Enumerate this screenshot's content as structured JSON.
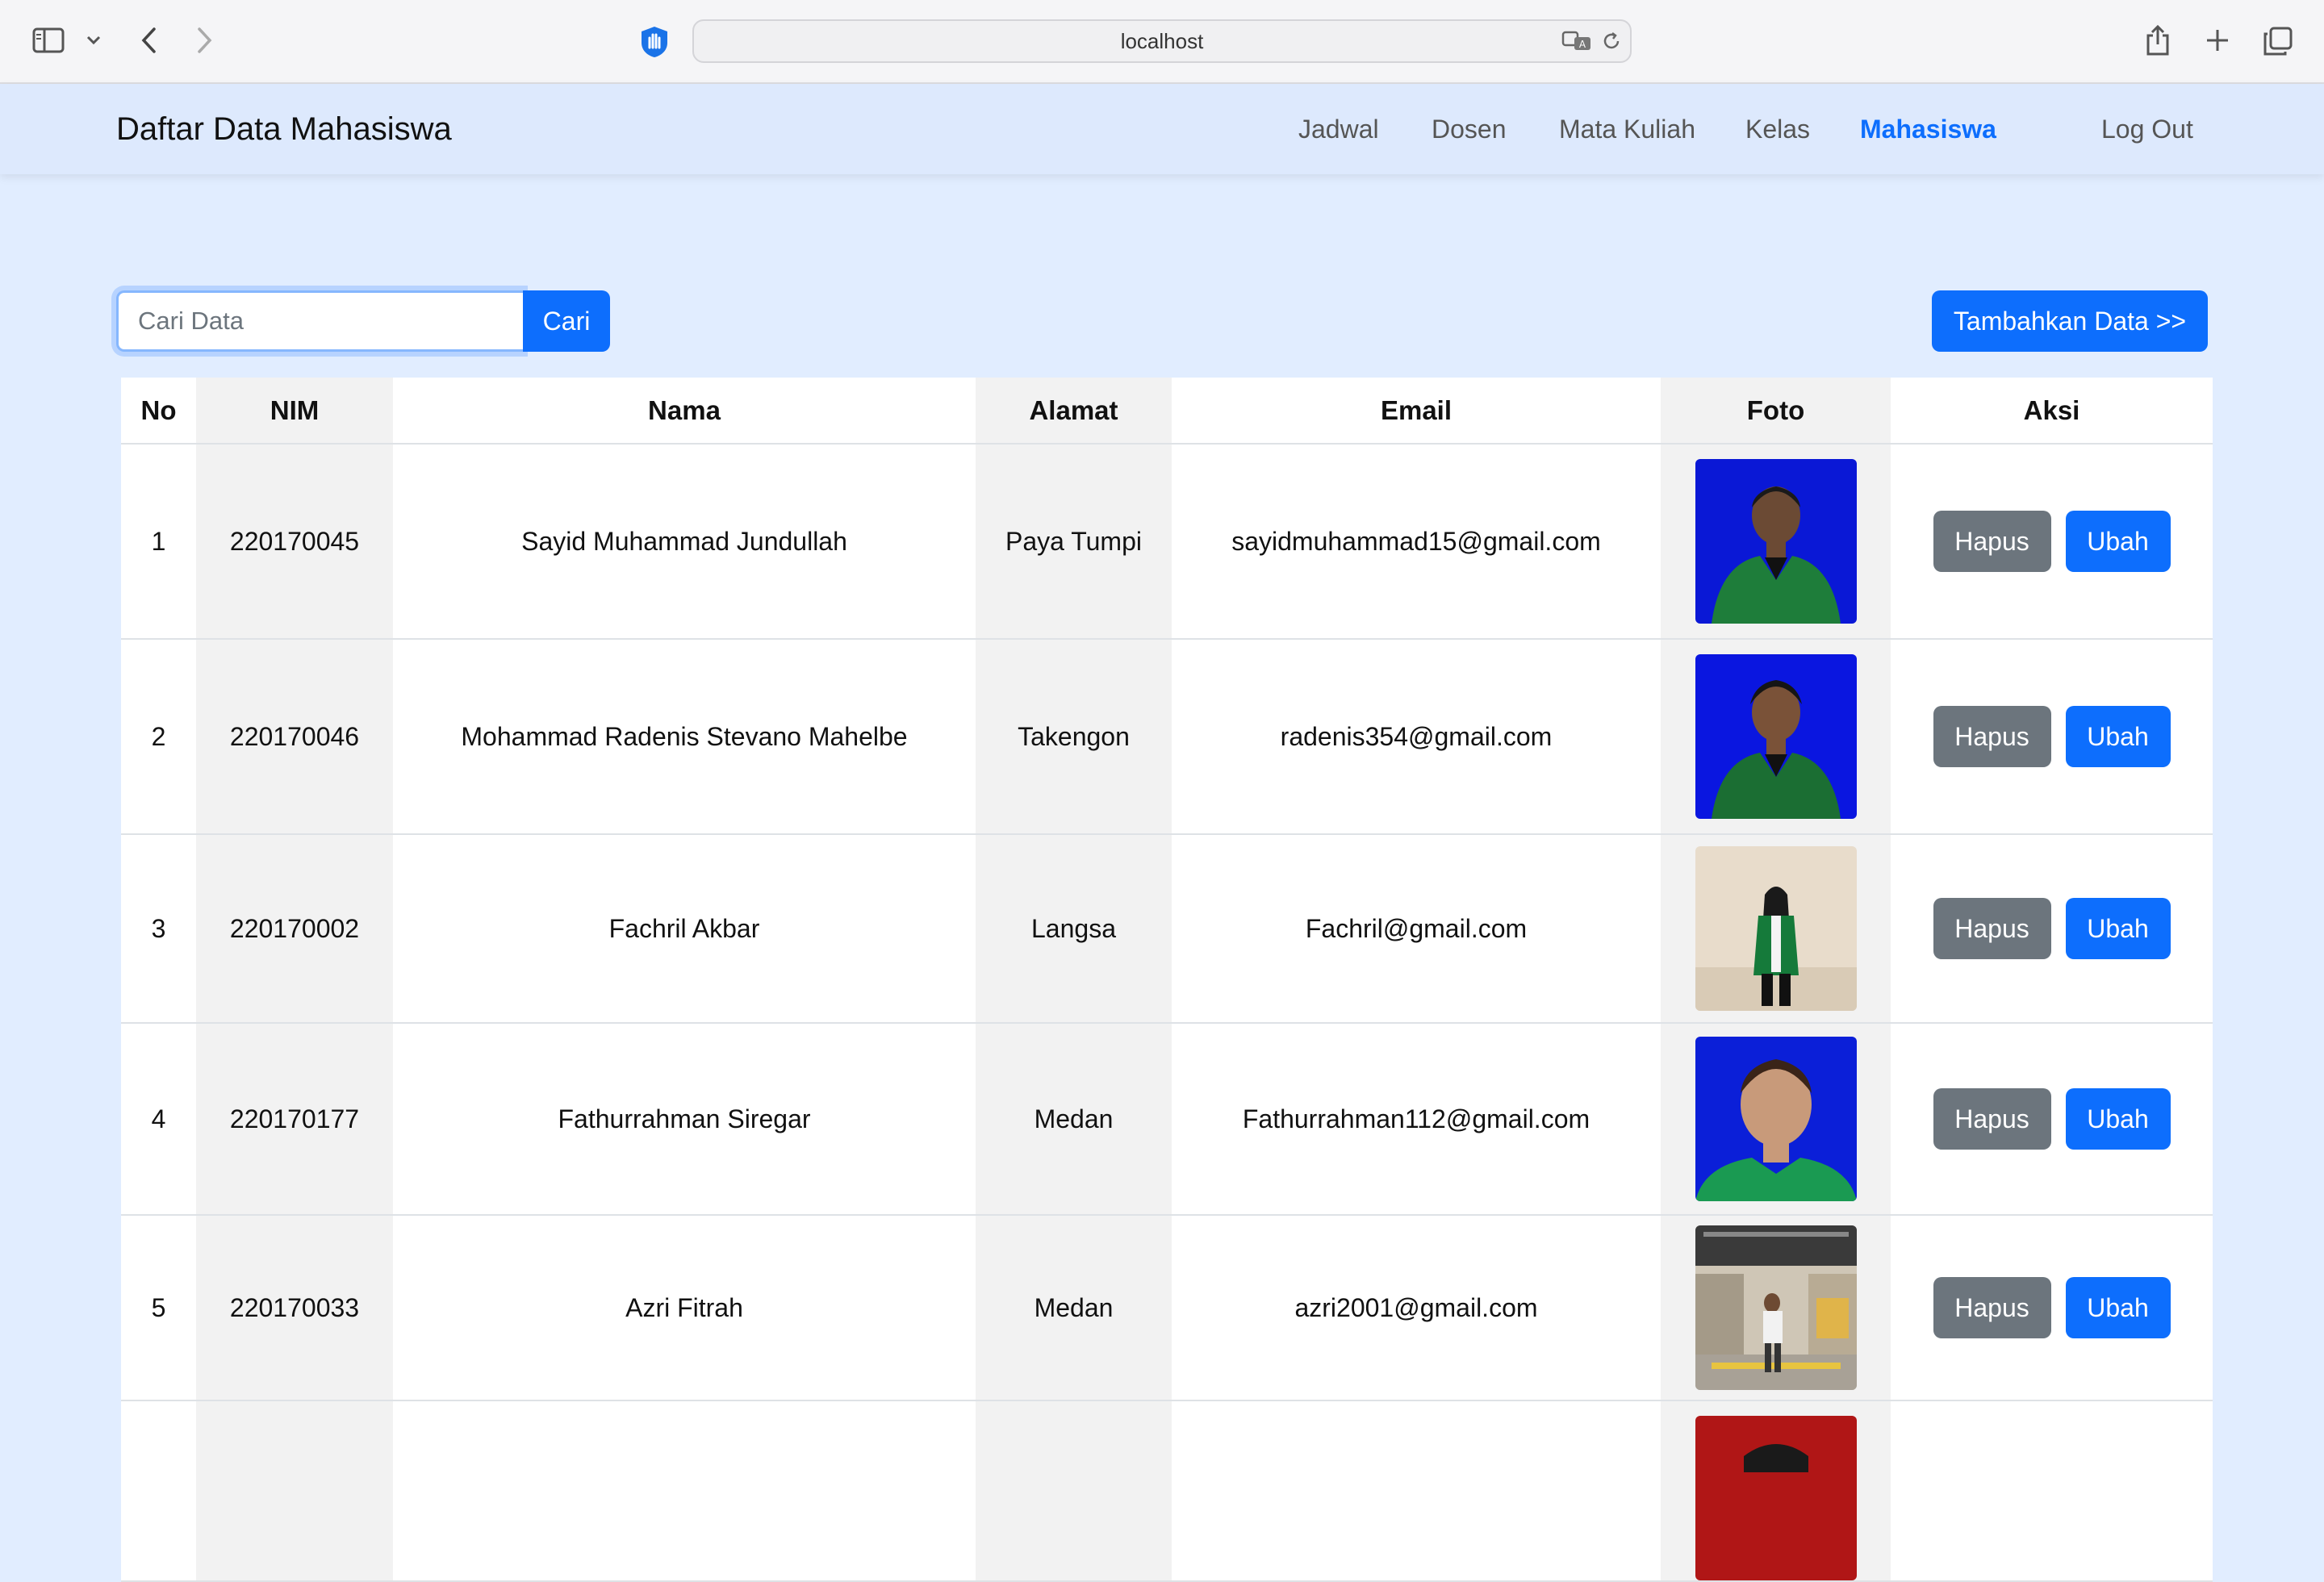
{
  "browser": {
    "url": "localhost",
    "icons": [
      "sidebar-icon",
      "chevron-down-icon",
      "back-icon",
      "forward-icon",
      "shield-icon",
      "translate-icon",
      "reload-icon",
      "share-icon",
      "new-tab-icon",
      "tabs-overview-icon"
    ]
  },
  "navbar": {
    "brand": "Daftar Data Mahasiswa",
    "links": [
      "Jadwal",
      "Dosen",
      "Mata Kuliah",
      "Kelas",
      "Mahasiswa"
    ],
    "active": "Mahasiswa",
    "logout": "Log Out",
    "accent_color": "#0d6efd"
  },
  "toolbar": {
    "search_placeholder": "Cari Data",
    "search_button": "Cari",
    "add_button": "Tambahkan Data >>"
  },
  "table": {
    "headers": [
      "No",
      "NIM",
      "Nama",
      "Alamat",
      "Email",
      "Foto",
      "Aksi"
    ],
    "delete_label": "Hapus",
    "edit_label": "Ubah",
    "rows": [
      {
        "no": "1",
        "nim": "220170045",
        "nama": "Sayid Muhammad Jundullah",
        "alamat": "Paya Tumpi",
        "email": "sayidmuhammad15@gmail.com"
      },
      {
        "no": "2",
        "nim": "220170046",
        "nama": "Mohammad Radenis Stevano Mahelbe",
        "alamat": "Takengon",
        "email": "radenis354@gmail.com"
      },
      {
        "no": "3",
        "nim": "220170002",
        "nama": "Fachril Akbar",
        "alamat": "Langsa",
        "email": "Fachril@gmail.com"
      },
      {
        "no": "4",
        "nim": "220170177",
        "nama": "Fathurrahman Siregar",
        "alamat": "Medan",
        "email": "Fathurrahman112@gmail.com"
      },
      {
        "no": "5",
        "nim": "220170033",
        "nama": "Azri Fitrah",
        "alamat": "Medan",
        "email": "azri2001@gmail.com"
      },
      {
        "no": "",
        "nim": "",
        "nama": "",
        "alamat": "",
        "email": ""
      }
    ]
  }
}
